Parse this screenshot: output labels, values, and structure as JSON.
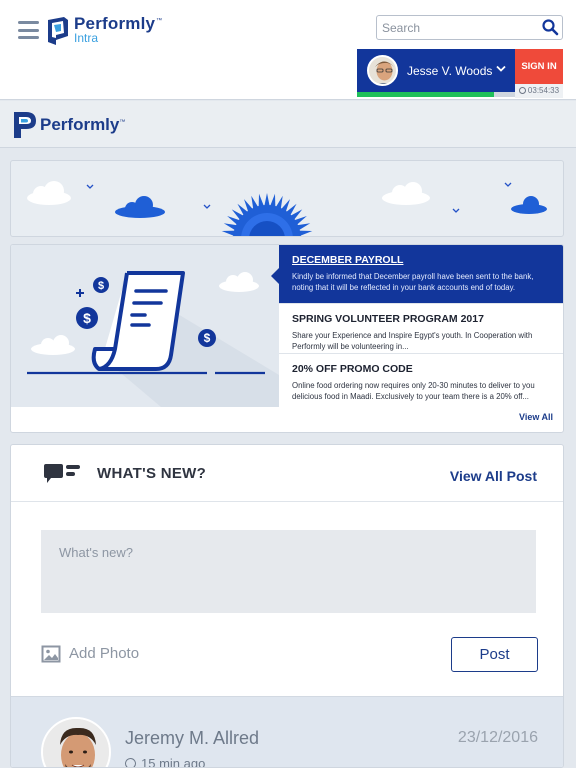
{
  "header": {
    "brand_name": "Performly",
    "brand_tm": "™",
    "brand_sub": "Intra",
    "search_placeholder": "Search",
    "user_name": "Jesse V. Woods",
    "signin_label": "SIGN IN",
    "timer": "03:54:33",
    "session_progress": 0.87,
    "accent_color": "#12369b",
    "signin_color": "#ef4a3a",
    "progress_color": "#1fc05a"
  },
  "brandbar": {
    "name": "Performly",
    "tm": "™"
  },
  "announcements": {
    "items": [
      {
        "title": "DECEMBER PAYROLL",
        "desc": "Kindly be informed that December payroll have been sent to the bank, noting that it will be reflected in your bank accounts end of today."
      },
      {
        "title": "SPRING VOLUNTEER PROGRAM 2017",
        "desc": "Share your Experience and Inspire Egypt's youth. In Cooperation with Performly will be volunteering in..."
      },
      {
        "title": "20% OFF PROMO CODE",
        "desc": "Online food ordering now requires only 20-30 minutes to deliver to you delicious food in Maadi. Exclusively to your team there is a 20% off..."
      }
    ],
    "view_all": "View All"
  },
  "whats_new": {
    "title": "WHAT'S NEW?",
    "view_all": "View All Post",
    "input_placeholder": "What's new?",
    "add_photo": "Add Photo",
    "post_label": "Post"
  },
  "feed": [
    {
      "name": "Jeremy M. Allred",
      "date": "23/12/2016",
      "time": "15 min ago"
    }
  ]
}
